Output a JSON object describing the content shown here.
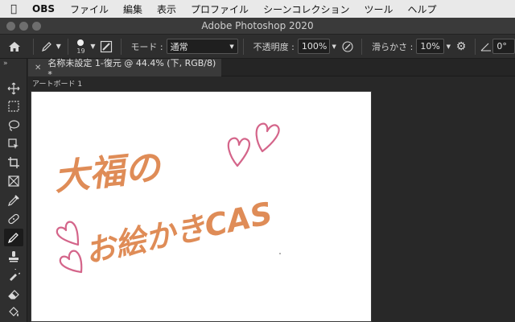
{
  "menubar": {
    "app_name": "OBS",
    "items": [
      "ファイル",
      "編集",
      "表示",
      "プロファイル",
      "シーンコレクション",
      "ツール",
      "ヘルプ"
    ]
  },
  "window": {
    "title": "Adobe Photoshop 2020"
  },
  "options_bar": {
    "brush_size": "19",
    "mode_label": "モード :",
    "mode_value": "通常",
    "opacity_label": "不透明度 :",
    "opacity_value": "100%",
    "smoothing_label": "滑らかさ :",
    "smoothing_value": "10%",
    "angle_value": "0°"
  },
  "document_tab": {
    "title": "名称未設定 1-復元 @ 44.4% (下, RGB/8) *"
  },
  "artboard": {
    "label": "アートボード 1"
  },
  "drawing": {
    "line1": "大福の",
    "line2": "お絵かきCAS",
    "text_color": "#df8c57",
    "heart_color": "#d4658a"
  },
  "colors": {
    "menubar_bg": "#e9e9e9",
    "panel_bg": "#2e2e2e",
    "workspace_bg": "#282828",
    "canvas_bg": "#ffffff"
  },
  "tools": [
    "move-icon",
    "marquee-icon",
    "lasso-icon",
    "object-select-icon",
    "crop-icon",
    "frame-icon",
    "eyedropper-icon",
    "healing-brush-icon",
    "brush-icon",
    "stamp-icon",
    "history-brush-icon",
    "eraser-icon",
    "paint-bucket-icon"
  ]
}
